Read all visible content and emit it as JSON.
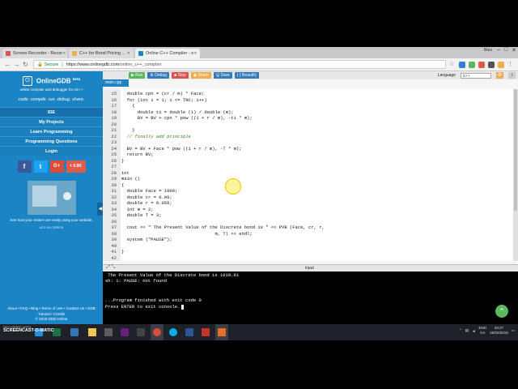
{
  "browser": {
    "tabs": [
      {
        "title": "Screen Recorder - Recor",
        "color": "#d9534f"
      },
      {
        "title": "C++ for Bond Pricing ...",
        "color": "#f0ad4e"
      },
      {
        "title": "Online C++ Compiler - o",
        "color": "#1b84c4"
      }
    ],
    "user": "Btex",
    "url_secure": "Secure",
    "url_host": "https://www.onlinegdb.com",
    "url_path": "/online_c++_compiler"
  },
  "sidebar": {
    "logo": "OnlineGDB",
    "beta": "beta",
    "tagline": "online compiler and debugger for c/c++",
    "motto": "code. compile. run. debug. share.",
    "menu": [
      "IDE",
      "My Projects",
      "Learn Programming",
      "Programming Questions",
      "Login"
    ],
    "social": [
      {
        "icon": "f",
        "color": "#3b5998"
      },
      {
        "icon": "t",
        "color": "#1da1f2"
      },
      {
        "icon": "G+",
        "color": "#dd4b39"
      },
      {
        "icon": "+",
        "label": "9.8K",
        "color": "#e25b4a"
      }
    ],
    "ad_text": "See how your visitors are really using your website.",
    "ad_via": "ADS VIA CARBON",
    "footer_line1": "About • FAQ • Blog • Terms of Use • Contact Us • GDB",
    "footer_line2": "Tutorial • Credits",
    "footer_line3": "© 2018 GDB Online"
  },
  "toolbar": {
    "buttons": [
      {
        "label": "▶ Run",
        "color": "#5cb85c"
      },
      {
        "label": "⚙ Debug",
        "color": "#337ab7"
      },
      {
        "label": "■ Stop",
        "color": "#d9534f"
      },
      {
        "label": "◉ Share",
        "color": "#f0ad4e"
      },
      {
        "label": "🖫 Save",
        "color": "#337ab7"
      },
      {
        "label": "{ } Beautify",
        "color": "#337ab7"
      }
    ],
    "language_label": "Language",
    "language_value": "C++"
  },
  "editor": {
    "file_tab": "main.cpp",
    "lines": [
      {
        "n": "15",
        "text": "  double cpn = (cr / m) * Face;"
      },
      {
        "n": "16",
        "text": "  for (int i = 1; i <= TNC; i++)"
      },
      {
        "n": "17",
        "text": "    {"
      },
      {
        "n": "18",
        "text": "      double ti = double (i) / double (m);"
      },
      {
        "n": "19",
        "text": "      BV = BV + cpn * pow ((1 + r / m), -ti * m);"
      },
      {
        "n": "20",
        "text": ""
      },
      {
        "n": "21",
        "text": "    }"
      },
      {
        "n": "22",
        "text": "  // finally add principle",
        "comment": true
      },
      {
        "n": "23",
        "text": ""
      },
      {
        "n": "24",
        "text": "  BV = BV + Face * pow ((1 + r / m), -T * m);"
      },
      {
        "n": "25",
        "text": "  return BV;"
      },
      {
        "n": "26",
        "text": "}"
      },
      {
        "n": "27",
        "text": ""
      },
      {
        "n": "28",
        "text": "int"
      },
      {
        "n": "29",
        "text": "main ()"
      },
      {
        "n": "30",
        "text": "{"
      },
      {
        "n": "31",
        "text": "  double Face = 1000;"
      },
      {
        "n": "32",
        "text": "  double cr = 0.06;"
      },
      {
        "n": "33",
        "text": "  double r = 0.056;"
      },
      {
        "n": "34",
        "text": "  int m = 2;"
      },
      {
        "n": "35",
        "text": "  double T = 3;"
      },
      {
        "n": "36",
        "text": ""
      },
      {
        "n": "37",
        "text": "  cout << \" The Present Value of the Discrete bond is \" << PVB (Face, cr, r,"
      },
      {
        "n": "38",
        "text": "                                   m, T) << endl;"
      },
      {
        "n": "39",
        "text": "  system (\"PAUSE\");"
      },
      {
        "n": "40",
        "text": ""
      },
      {
        "n": "41",
        "text": "}"
      },
      {
        "n": "42",
        "text": ""
      }
    ]
  },
  "output": {
    "input_label": "input",
    "lines": [
      " The Present Value of the Discrete bond is 1010.91",
      "sh: 1: PAUSE: not found",
      "",
      "",
      "...Program finished with exit code 0",
      "Press ENTER to exit console."
    ]
  },
  "taskbar": {
    "watermark_line1": "RECORDED WITH",
    "watermark_line2": "SCREENCAST-O-MATIC",
    "lang": "ENG",
    "region": "GA",
    "time": "20:27",
    "date": "25/02/2018"
  }
}
